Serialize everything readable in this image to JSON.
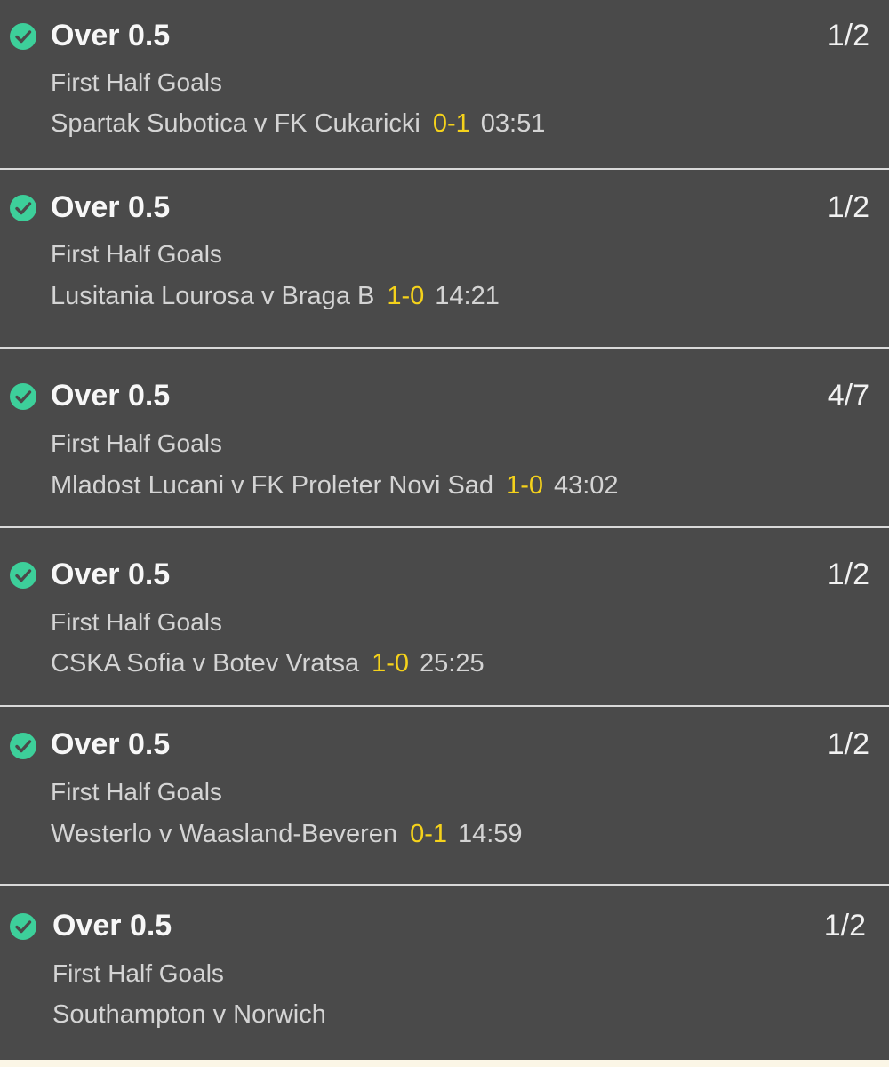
{
  "colors": {
    "background": "#4a4a4a",
    "divider": "#d9d9d9",
    "check": "#3dcf9a",
    "score": "#f5d21b",
    "bottom_strip": "#fbf6e6"
  },
  "bets": [
    {
      "icon": "check-circle-icon",
      "selection": "Over 0.5",
      "odds": "1/2",
      "market": "First Half Goals",
      "event": "Spartak Subotica v FK Cukaricki",
      "score": "0-1",
      "clock": "03:51"
    },
    {
      "icon": "check-circle-icon",
      "selection": "Over 0.5",
      "odds": "1/2",
      "market": "First Half Goals",
      "event": "Lusitania Lourosa v Braga B",
      "score": "1-0",
      "clock": "14:21"
    },
    {
      "icon": "check-circle-icon",
      "selection": "Over 0.5",
      "odds": "4/7",
      "market": "First Half Goals",
      "event": "Mladost Lucani v FK Proleter Novi Sad",
      "score": "1-0",
      "clock": "43:02"
    },
    {
      "icon": "check-circle-icon",
      "selection": "Over 0.5",
      "odds": "1/2",
      "market": "First Half Goals",
      "event": "CSKA Sofia v Botev Vratsa",
      "score": "1-0",
      "clock": "25:25"
    },
    {
      "icon": "check-circle-icon",
      "selection": "Over 0.5",
      "odds": "1/2",
      "market": "First Half Goals",
      "event": "Westerlo v Waasland-Beveren",
      "score": "0-1",
      "clock": "14:59"
    },
    {
      "icon": "check-circle-icon",
      "selection": "Over 0.5",
      "odds": "1/2",
      "market": "First Half Goals",
      "event": "Southampton v Norwich",
      "score": "",
      "clock": ""
    }
  ]
}
